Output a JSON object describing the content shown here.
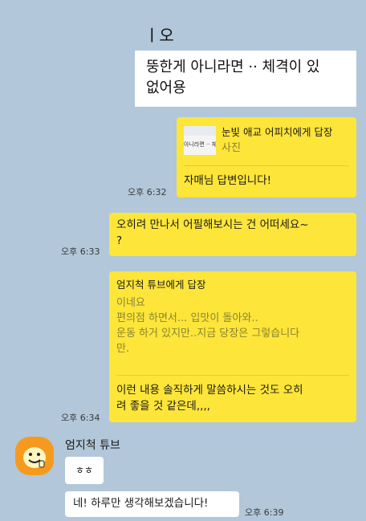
{
  "top_image": {
    "partial_char": "ㅣ오",
    "line1": "뚱한게 아니라면 ·· 체격이 있",
    "line2": "없어용"
  },
  "msg_reply1": {
    "reply_to": "눈빛 애교 어피치에게 답장",
    "reply_type": "사진",
    "thumb_text": "아니라면 ·· 체",
    "text": "자매님 답변입니다!",
    "time": "오후 6:32"
  },
  "msg2": {
    "text": "오히려 만나서 어필해보시는 건 어떠세요~\n?",
    "time": "오후 6:33"
  },
  "msg_reply2": {
    "reply_to": "엄지척 튜브에게 답장",
    "quoted": "이네요\n편의점 하면서... 입맛이 돌아와..\n운동 하거 있지만..지금 당장은 그렇습니다\n만.",
    "text": "이런 내용 솔직하게 말씀하시는 것도 오히\n려 좋을 것 같은데,,,,",
    "time": "오후 6:34"
  },
  "incoming": {
    "sender": "엄지척 튜브",
    "msg1": "ㅎㅎ",
    "msg2": "네! 하루만 생각해보겠습니다!",
    "time": "오후 6:39"
  },
  "colors": {
    "background": "#b2c7d9",
    "my_bubble": "#fde53a",
    "their_bubble": "#ffffff",
    "avatar": "#f59a1f"
  }
}
